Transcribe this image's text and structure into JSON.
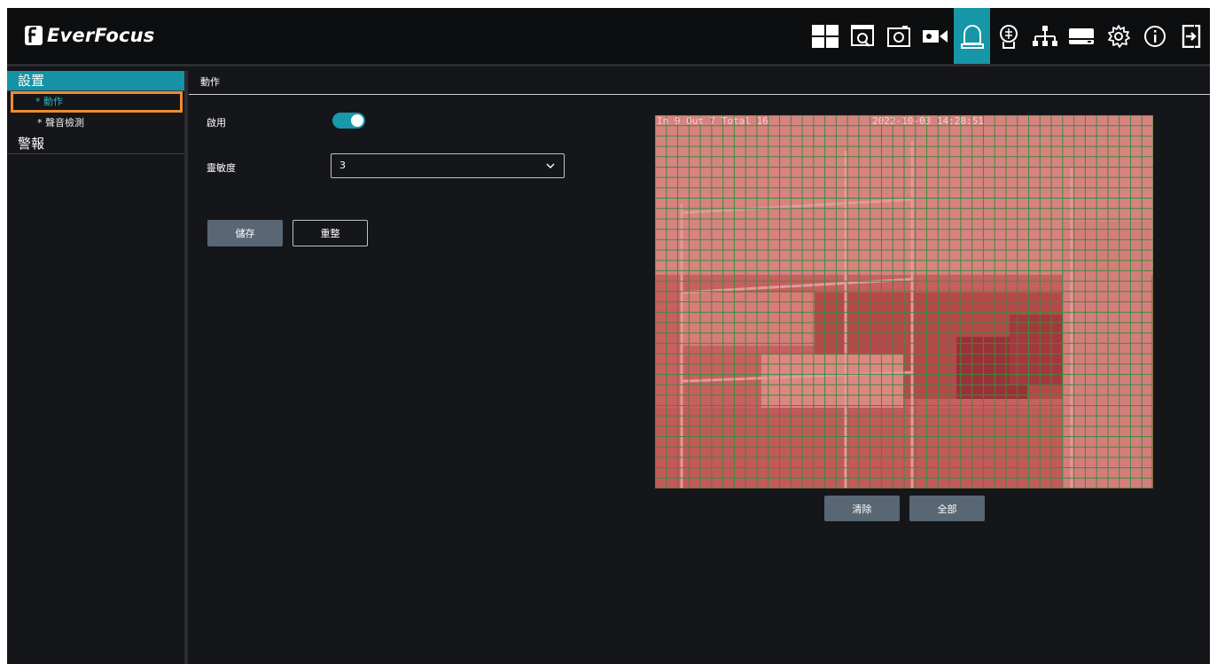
{
  "brand": {
    "name": "EverFocus"
  },
  "topnav": {
    "icons": [
      "layout-grid-icon",
      "playback-icon",
      "snapshot-icon",
      "camera-icon",
      "alarm-icon",
      "ai-face-icon",
      "network-icon",
      "storage-icon",
      "settings-gear-icon",
      "info-icon",
      "logout-icon"
    ],
    "active": "alarm-icon"
  },
  "sidebar": {
    "groups": [
      {
        "label": "設置",
        "active": true,
        "items": [
          {
            "label": "* 動作",
            "selected": true
          },
          {
            "label": "* 聲音檢測",
            "selected": false
          }
        ]
      },
      {
        "label": "警報",
        "active": false,
        "items": []
      }
    ]
  },
  "main": {
    "section_title": "動作",
    "enable": {
      "label": "啟用",
      "value": true
    },
    "sensitivity": {
      "label": "靈敏度",
      "value": "3"
    },
    "save_label": "儲存",
    "reset_label": "重整",
    "preview": {
      "stats": "In  9  Out  7  Total  16",
      "timestamp": "2022-10-03 14:28:51",
      "grid": {
        "columns": 44,
        "rows": 36,
        "selection": "all"
      }
    },
    "clear_label": "清除",
    "all_label": "全部"
  },
  "colors": {
    "accent": "#1696a7",
    "highlight_border": "#f08c2e",
    "grid_fill": "#d04848",
    "grid_line": "#3f8a3a"
  }
}
